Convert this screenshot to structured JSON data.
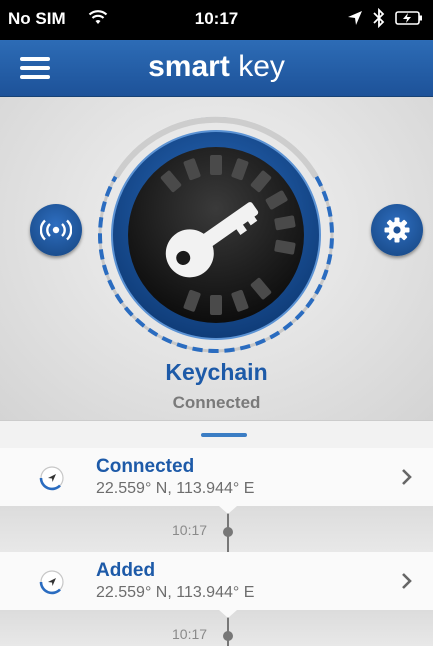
{
  "status_bar": {
    "carrier": "No SIM",
    "time": "10:17",
    "icons": [
      "wifi-icon",
      "location-arrow-icon",
      "bluetooth-icon",
      "battery-charging-icon"
    ]
  },
  "nav": {
    "brand_bold": "smart",
    "brand_light": "key",
    "menu_icon": "hamburger-menu-icon"
  },
  "hero": {
    "device_name": "Keychain",
    "device_status": "Connected",
    "left_button_icon": "broadcast-signal-icon",
    "right_button_icon": "gear-icon",
    "center_icon": "key-icon"
  },
  "events": [
    {
      "title": "Connected",
      "coords": "22.559° N, 113.944° E",
      "time": "10:17"
    },
    {
      "title": "Added",
      "coords": "22.559° N, 113.944° E",
      "time": "10:17"
    }
  ],
  "colors": {
    "accent": "#1d5aa8",
    "nav_bg": "#2d6cb6",
    "status_bg": "#000000"
  }
}
